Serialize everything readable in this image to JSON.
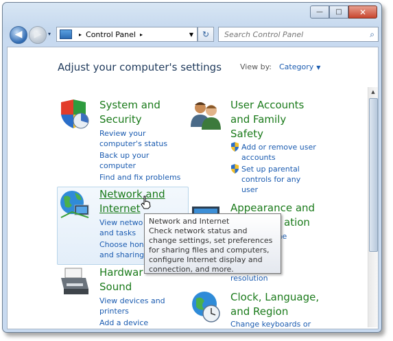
{
  "window": {
    "controls": {
      "minimize": "—",
      "maximize": "□",
      "close": "✕"
    }
  },
  "toolbar": {
    "back_glyph": "◀",
    "forward_glyph": "▶",
    "history_glyph": "▾",
    "address_segments": [
      "Control Panel"
    ],
    "address_sep": "▸",
    "address_dropdown": "▼",
    "refresh_glyph": "↻",
    "search_placeholder": "Search Control Panel"
  },
  "header": {
    "title": "Adjust your computer's settings",
    "view_by_label": "View by:",
    "view_by_value": "Category"
  },
  "categories": [
    {
      "title": "System and Security",
      "icon": "shield-pie-icon",
      "links": [
        "Review your computer's status",
        "Back up your computer",
        "Find and fix problems"
      ]
    },
    {
      "title": "User Accounts and Family Safety",
      "icon": "users-icon",
      "links": [
        "Add or remove user accounts",
        "Set up parental controls for any user"
      ]
    },
    {
      "title": "Network and Internet",
      "icon": "network-globe-icon",
      "links": [
        "View network status and tasks",
        "Choose homegroup and sharing options"
      ]
    },
    {
      "title": "Appearance and Personalization",
      "icon": "monitor-icon",
      "links": [
        "Change the theme",
        "Change desktop background",
        "Adjust screen resolution"
      ]
    },
    {
      "title": "Hardware and Sound",
      "icon": "printer-icon",
      "links": [
        "View devices and printers",
        "Add a device"
      ]
    },
    {
      "title": "Clock, Language, and Region",
      "icon": "globe-clock-icon",
      "links": [
        "Change keyboards or"
      ]
    }
  ],
  "visible_text": {
    "sys_title_1": "System and",
    "sys_title_2": "Security",
    "sys_link1_a": "Review your",
    "sys_link1_b": "computer's status",
    "sys_link2_a": "Back up your",
    "sys_link2_b": "computer",
    "sys_link3": "Find and fix problems",
    "ua_title_1": "User Accounts",
    "ua_title_2": "and Family",
    "ua_title_3": "Safety",
    "ua_link1_a": "Add or remove user",
    "ua_link1_b": "accounts",
    "ua_link2_a": "Set up parental",
    "ua_link2_b": "controls for any",
    "ua_link2_c": "user",
    "net_title_1": "Network and",
    "net_title_2": "Internet",
    "net_link1_a": "View netwo",
    "net_link1_b": "and tasks",
    "net_link2_a": "Choose hon",
    "net_link2_b": "and sharing",
    "app_title_1": "Appearance and",
    "app_title_2": "ation",
    "app_link1": "eme",
    "app_link2": "op",
    "app_link3": "resolution",
    "hw_title_1": "Hardwar",
    "hw_title_2": "Sound",
    "hw_link1_a": "View devices and",
    "hw_link1_b": "printers",
    "hw_link2": "Add a device",
    "clk_title_1": "Clock, Language,",
    "clk_title_2": "and Region",
    "clk_link1": "Change keyboards or"
  },
  "tooltip": {
    "title": "Network and Internet",
    "body": "Check network status and change settings, set preferences for sharing files and computers, configure Internet display and connection, and more."
  },
  "scrollbar": {
    "up_glyph": "▲"
  }
}
